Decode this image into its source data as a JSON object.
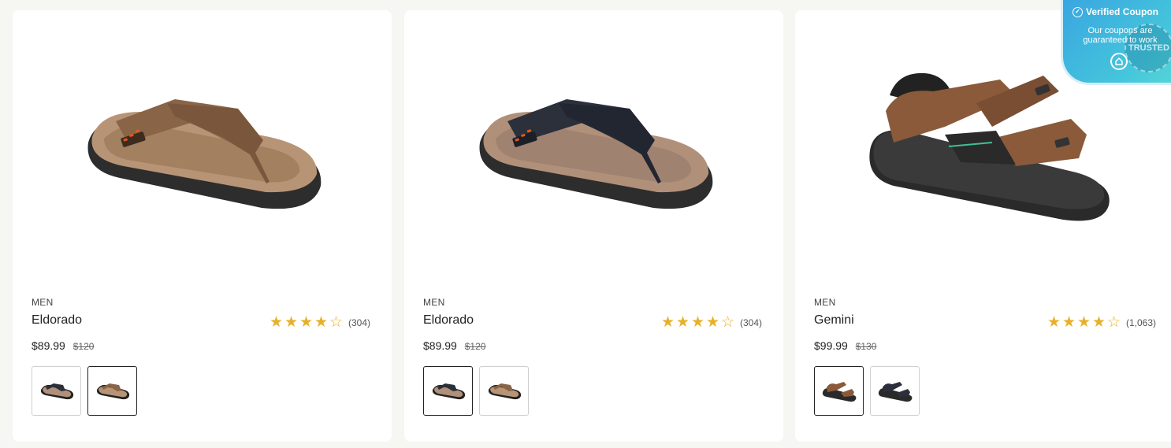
{
  "products": [
    {
      "category": "MEN",
      "name": "Eldorado",
      "price": "$89.99",
      "old_price": "$120",
      "rating": 4,
      "review_count": "(304)",
      "image": "brown-flip-flop-sandal",
      "swatches": [
        {
          "color": "black",
          "selected": false
        },
        {
          "color": "brown",
          "selected": true
        }
      ]
    },
    {
      "category": "MEN",
      "name": "Eldorado",
      "price": "$89.99",
      "old_price": "$120",
      "rating": 4,
      "review_count": "(304)",
      "image": "navy-flip-flop-sandal",
      "swatches": [
        {
          "color": "black",
          "selected": true
        },
        {
          "color": "brown",
          "selected": false
        }
      ]
    },
    {
      "category": "MEN",
      "name": "Gemini",
      "price": "$99.99",
      "old_price": "$130",
      "rating": 4,
      "review_count": "(1,063)",
      "image": "brown-strap-sport-sandal",
      "swatches": [
        {
          "color": "brown",
          "selected": true
        },
        {
          "color": "black",
          "selected": false
        }
      ]
    }
  ],
  "coupon_badge": {
    "title": "Verified Coupon",
    "subtitle_line1": "Our coupons are",
    "subtitle_line2": "guaranteed to work",
    "seal_text": "TRUSTED"
  },
  "colors": {
    "star": "#e8b02a",
    "page_bg": "#f6f6f3",
    "badge_blue": "#3aa6e0"
  }
}
